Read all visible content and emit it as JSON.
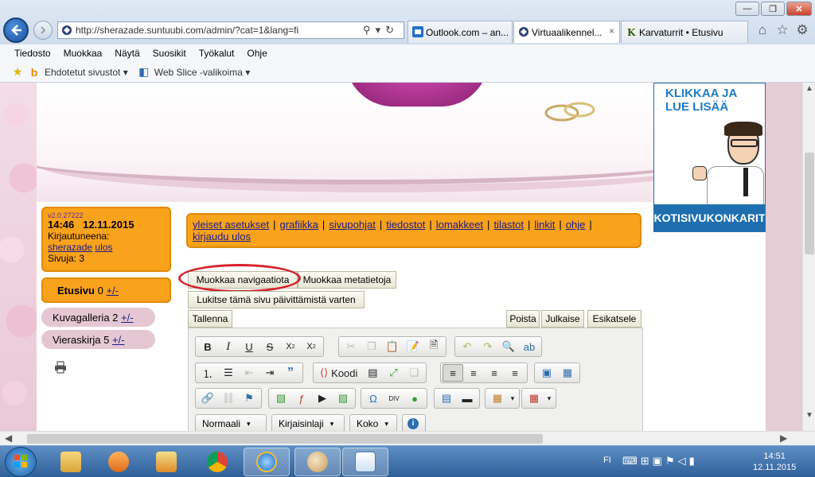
{
  "window": {
    "minimize": "—",
    "restore": "❐",
    "close": "✕"
  },
  "browser": {
    "address": "http://sherazade.suntuubi.com/admin/?cat=1&lang=fi",
    "tabs": [
      {
        "label": "Outlook.com – an...",
        "icon_color": "#1e6fd1"
      },
      {
        "label": "Virtuaalikennel...",
        "icon_color": "#1d3a7a"
      },
      {
        "label": "Karvaturrit • Etusivu",
        "icon_color": "#2a5a2a"
      }
    ],
    "tab_close": "×"
  },
  "menubar": {
    "items": [
      "Tiedosto",
      "Muokkaa",
      "Näytä",
      "Suosikit",
      "Työkalut",
      "Ohje"
    ]
  },
  "favbar": {
    "suggested": "Ehdotetut sivustot ▾",
    "webslice": "Web Slice -valikoima ▾"
  },
  "ad": {
    "line1": "KLIKKAA JA",
    "line2": "LUE LISÄÄ",
    "bottom": "KOTISIVUKONKARIT"
  },
  "info": {
    "version": "v2.0.27222",
    "time": "14:46",
    "date": "12.11.2015",
    "logged_label": "Kirjautuneena:",
    "user": "sherazade",
    "logout": "ulos",
    "pages": "Sivuja: 3"
  },
  "nav": {
    "etusivu": {
      "label": "Etusivu",
      "count": "0",
      "pm": "+/-"
    },
    "kuvagalleria": {
      "label": "Kuvagalleria",
      "count": "2",
      "pm": "+/-"
    },
    "vieraskirja": {
      "label": "Vieraskirja",
      "count": "5",
      "pm": "+/-"
    }
  },
  "admin_menu": {
    "items": [
      "yleiset asetukset",
      "grafiikka",
      "sivupohjat",
      "tiedostot",
      "lomakkeet",
      "tilastot",
      "linkit",
      "ohje",
      "kirjaudu ulos"
    ]
  },
  "buttons": {
    "edit_nav": "Muokkaa navigaatiota",
    "edit_meta": "Muokkaa metatietoja",
    "lock": "Lukitse tämä sivu päivittämistä varten",
    "save": "Tallenna",
    "delete": "Poista",
    "publish": "Julkaise",
    "preview": "Esikatsele"
  },
  "editor": {
    "code_label": "Koodi",
    "format": "Normaali",
    "font": "Kirjaisinlaji",
    "size": "Koko"
  },
  "tray": {
    "lang": "FI",
    "time": "14:51",
    "date": "12.11.2015"
  }
}
